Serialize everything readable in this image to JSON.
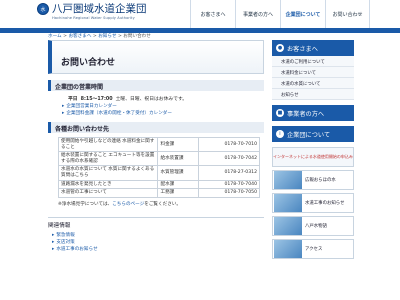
{
  "header": {
    "logo_mark": "水",
    "title": "八戸圏域水道企業団",
    "subtitle": "Hachinohe Regional Water Supply Authority",
    "nav": [
      "お客さまへ",
      "事業者の方へ",
      "企業団について",
      "お問い合わせ"
    ]
  },
  "breadcrumb": {
    "home": "ホーム",
    "sep": " > ",
    "customers": "お客さまへ",
    "notice": "お知らせ",
    "current": "お問い合わせ"
  },
  "page_title": "お問い合わせ",
  "hours_section": {
    "heading": "企業団の営業時間",
    "day_label": "平日",
    "time": "8:15～17:00",
    "closed": "土曜、日曜、祝日はお休みです。",
    "links": [
      "企業団営業日カレンダー",
      "企業団料金課（水道の開栓・休了受付）カレンダー"
    ]
  },
  "contact_section": {
    "heading": "各種お問い合わせ先",
    "rows": [
      {
        "topic": "使用開始や引越しなどの連絡 水道料金に関すること",
        "dept": "料金課",
        "phone": "0178-70-7010"
      },
      {
        "topic": "給水装置に関すること エコキュート等を設置する際の水系確認",
        "dept": "給水装置課",
        "phone": "0178-70-7042"
      },
      {
        "topic": "水道水の水質について 水質に関するよくある質問はこちら",
        "dept": "水質管理課",
        "phone": "0178-27-0312"
      },
      {
        "topic": "道路漏水を発見したとき",
        "dept": "配水課",
        "phone": "0178-70-7040"
      },
      {
        "topic": "水道管の工事について",
        "dept": "工務課",
        "phone": "0178-70-7050"
      }
    ],
    "note_prefix": "※浄水場見学については、",
    "note_link": "こちらのページ",
    "note_suffix": "をご覧ください。"
  },
  "related": {
    "heading": "関連情報",
    "items": [
      "緊急情報",
      "支店対策",
      "水道工事のお知らせ"
    ]
  },
  "sidebar": {
    "customers_title": "お客さまへ",
    "customers_items": [
      "水道のご利用について",
      "水道料金について",
      "水道の水質について",
      "お知らせ"
    ],
    "business_title": "事業者の方へ",
    "corp_title": "企業団について",
    "banners": [
      "インターネットによる水道使用開始の申込み",
      "広報おらほの水",
      "水道工事のお知らせ",
      "八戸水物語",
      "アクセス"
    ]
  }
}
